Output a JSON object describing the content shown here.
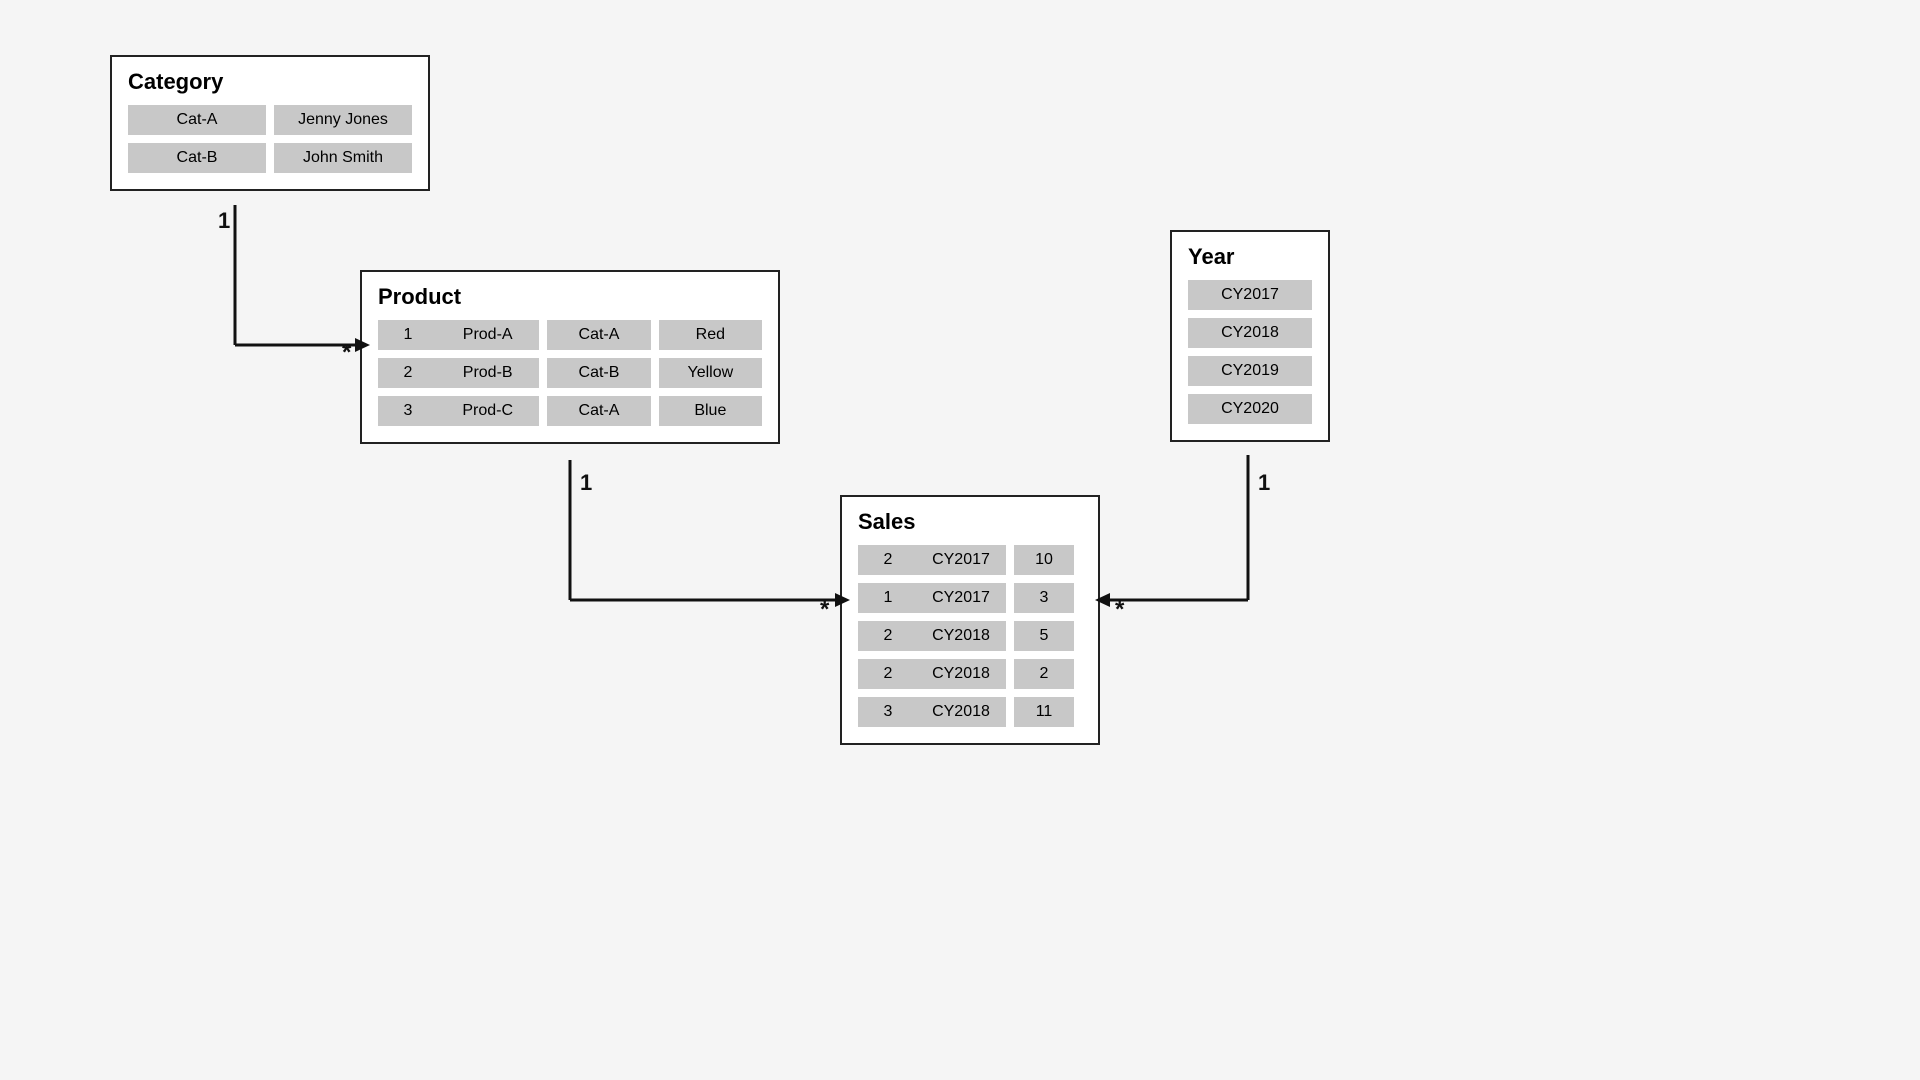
{
  "category": {
    "title": "Category",
    "rows": [
      [
        "Cat-A",
        "Jenny Jones"
      ],
      [
        "Cat-B",
        "John Smith"
      ]
    ]
  },
  "product": {
    "title": "Product",
    "rows": [
      [
        "1",
        "Prod-A",
        "Cat-A",
        "Red"
      ],
      [
        "2",
        "Prod-B",
        "Cat-B",
        "Yellow"
      ],
      [
        "3",
        "Prod-C",
        "Cat-A",
        "Blue"
      ]
    ]
  },
  "year": {
    "title": "Year",
    "rows": [
      [
        "CY2017"
      ],
      [
        "CY2018"
      ],
      [
        "CY2019"
      ],
      [
        "CY2020"
      ]
    ]
  },
  "sales": {
    "title": "Sales",
    "rows": [
      [
        "2",
        "CY2017",
        "10"
      ],
      [
        "1",
        "CY2017",
        "3"
      ],
      [
        "2",
        "CY2018",
        "5"
      ],
      [
        "2",
        "CY2018",
        "2"
      ],
      [
        "3",
        "CY2018",
        "11"
      ]
    ]
  },
  "connectors": {
    "cat_to_prod_label_one": "1",
    "cat_to_prod_label_many": "*",
    "prod_to_sales_label_one": "1",
    "prod_to_sales_label_many": "*",
    "year_to_sales_label_one": "1",
    "year_to_sales_label_many": "*"
  }
}
